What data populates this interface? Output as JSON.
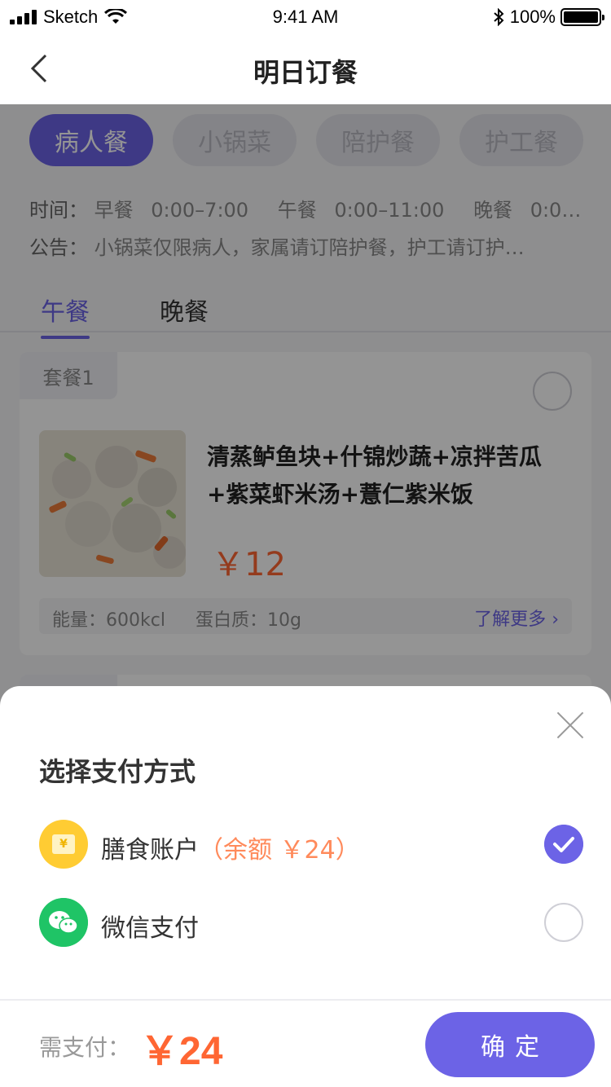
{
  "status_bar": {
    "carrier": "Sketch",
    "time": "9:41 AM",
    "battery": "100%"
  },
  "nav": {
    "title": "明日订餐"
  },
  "categories": [
    {
      "label": "病人餐",
      "active": true
    },
    {
      "label": "小锅菜",
      "active": false
    },
    {
      "label": "陪护餐",
      "active": false
    },
    {
      "label": "护工餐",
      "active": false
    }
  ],
  "time_info": {
    "label": "时间：",
    "breakfast_name": "早餐",
    "breakfast_time": "0:00–7:00",
    "lunch_name": "午餐",
    "lunch_time": "0:00–11:00",
    "dinner_name": "晚餐",
    "dinner_time": "0:00…"
  },
  "notice": {
    "label": "公告：",
    "text": "小锅菜仅限病人，家属请订陪护餐，护工请订护…"
  },
  "meal_tabs": [
    {
      "label": "午餐",
      "active": true
    },
    {
      "label": "晚餐",
      "active": false
    }
  ],
  "meal_card": {
    "tag": "套餐1",
    "name": "清蒸鲈鱼块+什锦炒蔬+凉拌苦瓜+紫菜虾米汤+薏仁紫米饭",
    "price": "￥12",
    "energy": "能量：600kcl",
    "protein": "蛋白质：10g",
    "more": "了解更多"
  },
  "payment_sheet": {
    "title": "选择支付方式",
    "options": [
      {
        "label": "膳食账户",
        "balance": "（余额 ￥24）",
        "icon": "account-card-icon",
        "icon_text": "¥",
        "selected": true
      },
      {
        "label": "微信支付",
        "balance": "",
        "icon": "wechat-icon",
        "selected": false
      }
    ],
    "total_label": "需支付：",
    "total": "￥24",
    "confirm": "确定"
  },
  "colors": {
    "accent": "#6c63e6",
    "price": "#ff6633",
    "balance": "#ff8a5b",
    "wechat": "#1fc466",
    "account": "#ffcc33"
  }
}
